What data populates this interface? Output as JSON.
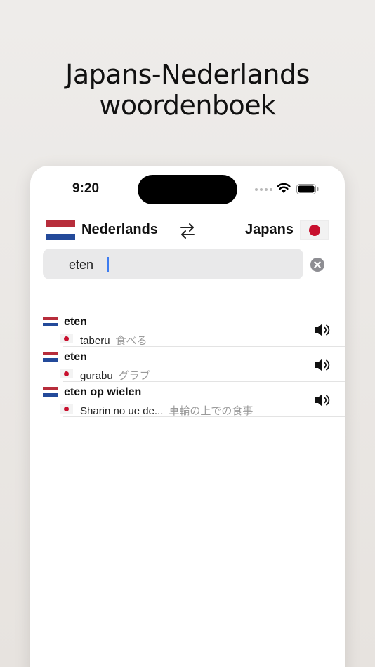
{
  "headline": {
    "line1": "Japans-Nederlands",
    "line2": "woordenboek"
  },
  "status_bar": {
    "time": "9:20",
    "icons": [
      "signal-dots-icon",
      "wifi-icon",
      "battery-icon"
    ]
  },
  "language_bar": {
    "source_language": "Nederlands",
    "source_flag": "netherlands-flag-icon",
    "swap_icon": "swap-arrows-icon",
    "target_language": "Japans",
    "target_flag": "japan-flag-icon"
  },
  "search": {
    "value": "eten",
    "clear_icon": "clear-circle-icon"
  },
  "results": [
    {
      "term": "eten",
      "reading": "taberu",
      "japanese": "食べる"
    },
    {
      "term": "eten",
      "reading": "gurabu",
      "japanese": "グラブ"
    },
    {
      "term": "eten op wielen",
      "reading": "Sharin no ue de...",
      "japanese": "車輪の上での食事"
    }
  ],
  "colors": {
    "background": "#eceae7",
    "dutch_red": "#b72d3b",
    "dutch_blue": "#234a9a",
    "japan_red": "#c8102e",
    "caret_blue": "#3d7cf0"
  }
}
